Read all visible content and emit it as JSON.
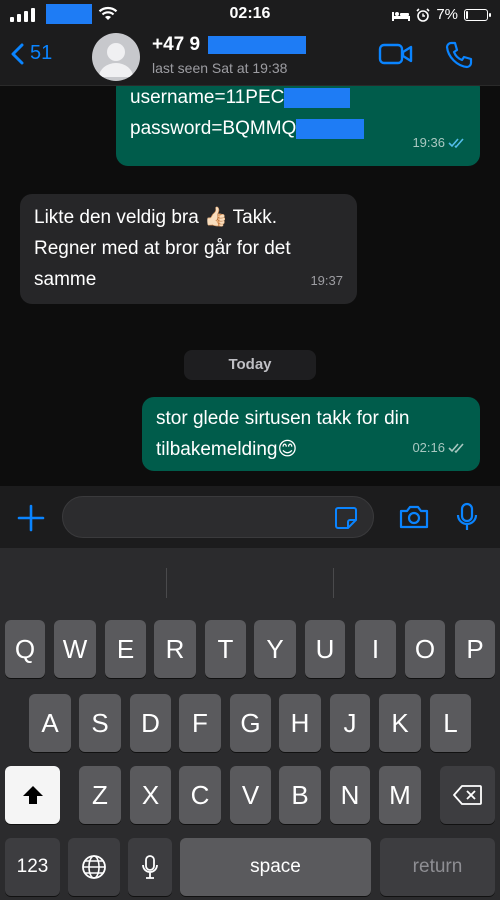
{
  "status": {
    "time": "02:16",
    "battery": "7%",
    "battery_level": 0.07
  },
  "header": {
    "back_count": "51",
    "contact_name": "+47 9",
    "last_seen": "last seen Sat at 19:38"
  },
  "messages": [
    {
      "direction": "outgoing",
      "line1": "username=11PEC",
      "line2": "password=BQMMQ",
      "time": "19:36",
      "read": true
    },
    {
      "direction": "incoming",
      "line1": "Likte den veldig bra 👍🏻 Takk.",
      "line2": "Regner med at bror går for det",
      "line3": "samme",
      "time": "19:37"
    },
    {
      "direction": "outgoing",
      "line1": "stor glede sirtusen takk for din",
      "line2": "tilbakemelding😊",
      "time": "02:16",
      "read": true
    }
  ],
  "date_divider": "Today",
  "composer": {
    "value": ""
  },
  "keyboard": {
    "row1": [
      "Q",
      "W",
      "E",
      "R",
      "T",
      "Y",
      "U",
      "I",
      "O",
      "P"
    ],
    "row2": [
      "A",
      "S",
      "D",
      "F",
      "G",
      "H",
      "J",
      "K",
      "L"
    ],
    "row3": [
      "Z",
      "X",
      "C",
      "V",
      "B",
      "N",
      "M"
    ],
    "numbers_key": "123",
    "space_key": "space",
    "return_key": "return"
  },
  "icons": {
    "back": "chevron-left-icon",
    "video": "video-camera-icon",
    "call": "phone-icon",
    "plus": "plus-icon",
    "sticker": "sticker-icon",
    "camera": "camera-icon",
    "mic": "microphone-icon",
    "shift": "shift-arrow-icon",
    "delete": "backspace-icon",
    "globe": "globe-icon"
  },
  "colors": {
    "accent": "#0a84ff",
    "outgoing_bubble": "#005c4b",
    "incoming_bubble": "#262628",
    "redaction": "#1e7cf5"
  }
}
